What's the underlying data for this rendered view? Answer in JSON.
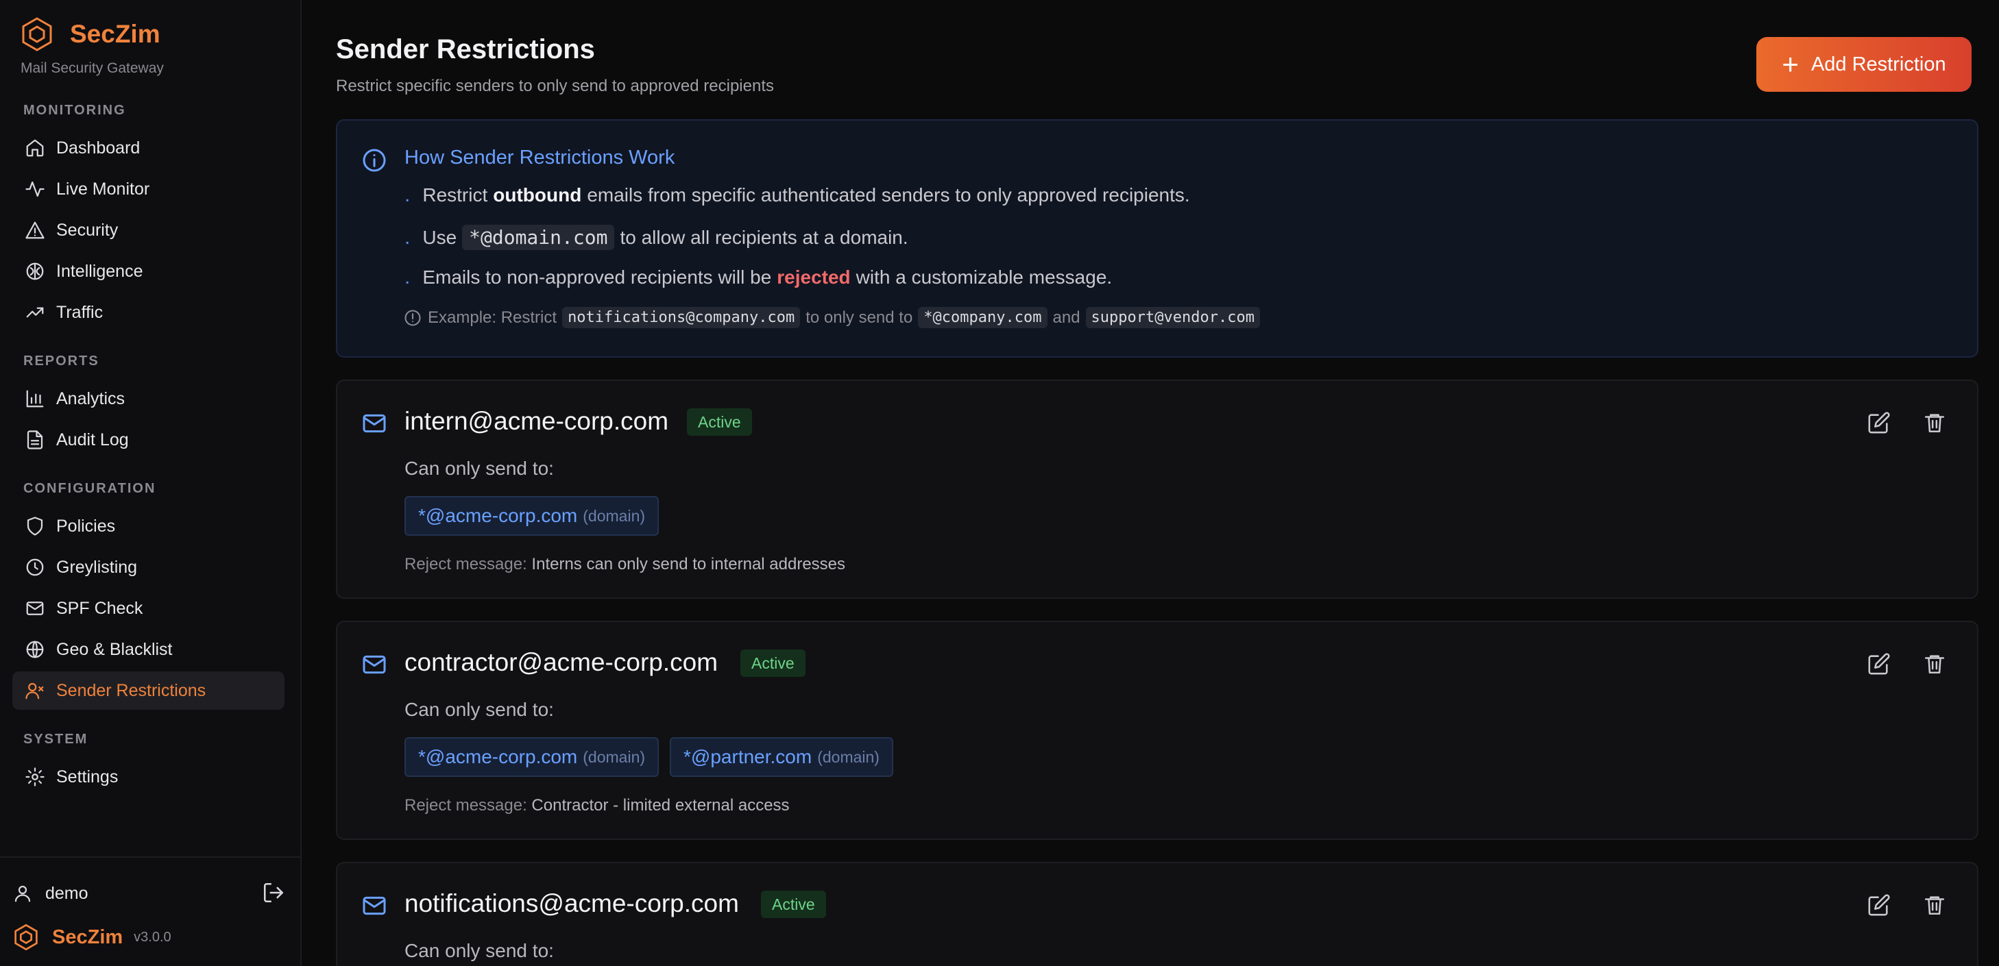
{
  "brand": {
    "name": "SecZim",
    "subtitle": "Mail Security Gateway",
    "version": "v3.0.0",
    "accent": "#f0823c"
  },
  "sidebar": {
    "sections": [
      {
        "label": "MONITORING",
        "items": [
          {
            "label": "Dashboard",
            "icon": "home-icon"
          },
          {
            "label": "Live Monitor",
            "icon": "activity-icon"
          },
          {
            "label": "Security",
            "icon": "warning-icon"
          },
          {
            "label": "Intelligence",
            "icon": "brain-icon"
          },
          {
            "label": "Traffic",
            "icon": "trending-up-icon"
          }
        ]
      },
      {
        "label": "REPORTS",
        "items": [
          {
            "label": "Analytics",
            "icon": "bar-chart-icon"
          },
          {
            "label": "Audit Log",
            "icon": "file-text-icon"
          }
        ]
      },
      {
        "label": "CONFIGURATION",
        "items": [
          {
            "label": "Policies",
            "icon": "shield-icon"
          },
          {
            "label": "Greylisting",
            "icon": "clock-icon"
          },
          {
            "label": "SPF Check",
            "icon": "mail-icon"
          },
          {
            "label": "Geo & Blacklist",
            "icon": "globe-icon"
          },
          {
            "label": "Sender Restrictions",
            "icon": "user-x-icon",
            "active": true
          }
        ]
      },
      {
        "label": "SYSTEM",
        "items": [
          {
            "label": "Settings",
            "icon": "gear-icon"
          }
        ]
      }
    ],
    "user": "demo"
  },
  "page": {
    "title": "Sender Restrictions",
    "subtitle": "Restrict specific senders to only send to approved recipients",
    "add_label": "Add Restriction"
  },
  "info": {
    "title": "How Sender Restrictions Work",
    "b1_pre": "Restrict",
    "b1_bold": "outbound",
    "b1_post": "emails from specific authenticated senders to only approved recipients.",
    "b2_pre": "Use",
    "b2_code": "*@domain.com",
    "b2_post": "to allow all recipients at a domain.",
    "b3_pre": "Emails to non-approved recipients will be",
    "b3_red": "rejected",
    "b3_post": "with a customizable message.",
    "ex_pre": "Example: Restrict",
    "ex_code1": "notifications@company.com",
    "ex_mid": "to only send to",
    "ex_code2": "*@company.com",
    "ex_and": "and",
    "ex_code3": "support@vendor.com"
  },
  "cards": [
    {
      "email": "intern@acme-corp.com",
      "status": "Active",
      "label": "Can only send to:",
      "chips": [
        {
          "value": "*@acme-corp.com",
          "kind": "(domain)"
        }
      ],
      "reject_label": "Reject message:",
      "reject_text": "Interns can only send to internal addresses"
    },
    {
      "email": "contractor@acme-corp.com",
      "status": "Active",
      "label": "Can only send to:",
      "chips": [
        {
          "value": "*@acme-corp.com",
          "kind": "(domain)"
        },
        {
          "value": "*@partner.com",
          "kind": "(domain)"
        }
      ],
      "reject_label": "Reject message:",
      "reject_text": "Contractor - limited external access"
    },
    {
      "email": "notifications@acme-corp.com",
      "status": "Active",
      "label": "Can only send to:"
    }
  ]
}
